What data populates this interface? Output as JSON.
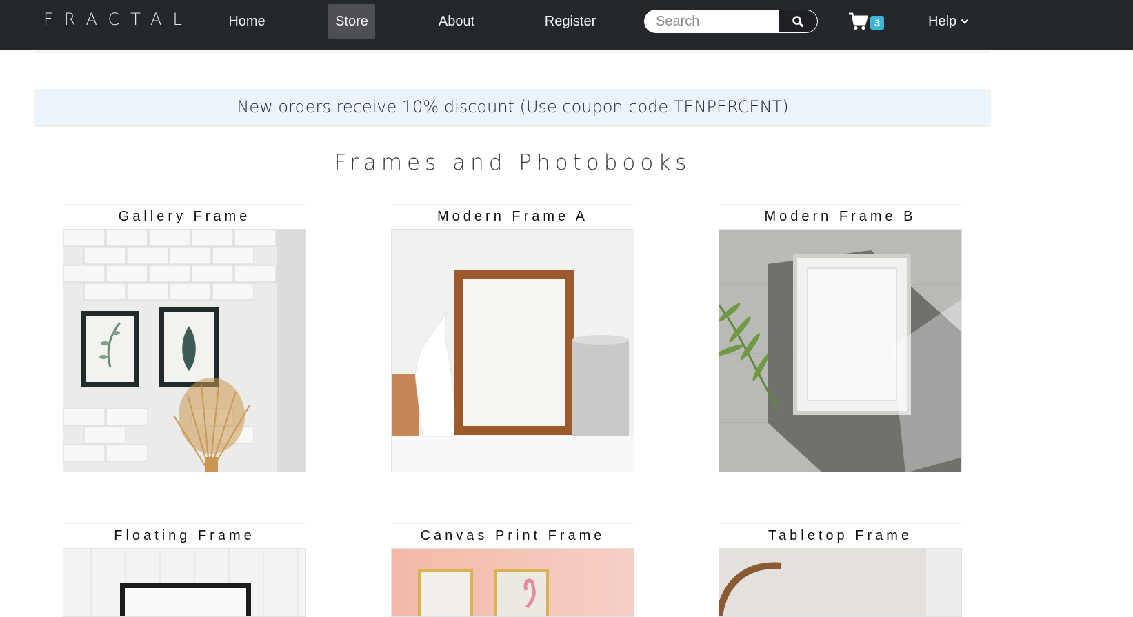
{
  "navbar": {
    "brand": "FRACTAL",
    "links": {
      "home": "Home",
      "store": "Store",
      "about": "About",
      "register": "Register"
    },
    "search": {
      "placeholder": "Search"
    },
    "cart_count": "3",
    "help_label": "Help",
    "bg_color": "#24272b"
  },
  "promo": {
    "text": "New orders receive 10% discount (Use coupon code TENPERCENT)",
    "bg_color": "#ebf4fb"
  },
  "section": {
    "title": "Frames and Photobooks"
  },
  "products": [
    {
      "title": "Gallery Frame",
      "image": "white-brick-wall-with-two-botanical-prints-and-dried-grass"
    },
    {
      "title": "Modern Frame A",
      "image": "copper-frame-with-antler-and-vase"
    },
    {
      "title": "Modern Frame B",
      "image": "white-frame-on-wood-with-palm-shadow"
    },
    {
      "title": "Floating Frame",
      "image": "black-frame-on-white-planks"
    },
    {
      "title": "Canvas Print Frame",
      "image": "gold-frames-on-pink-wall"
    },
    {
      "title": "Tabletop Frame",
      "image": "round-wooden-frame-on-beige"
    }
  ]
}
